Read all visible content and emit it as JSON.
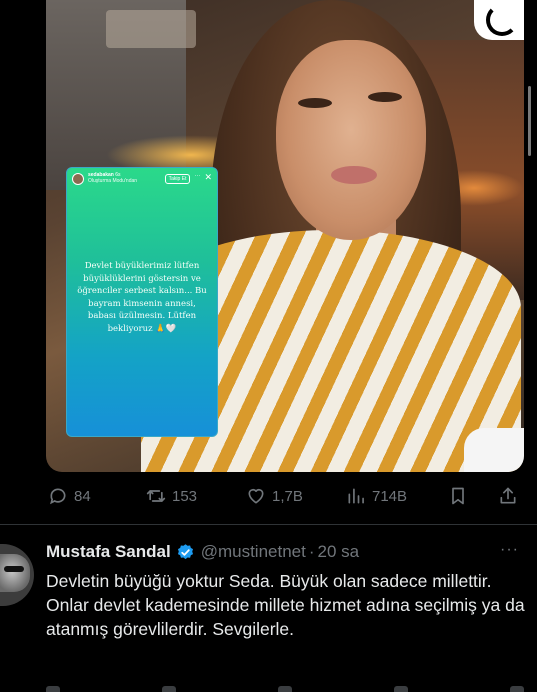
{
  "media": {
    "story": {
      "username": "sedabakan",
      "time": "6s",
      "subtitle": "Oluşturma Modu'ndan",
      "follow_label": "Takip Et",
      "more_glyph": "···",
      "close_glyph": "✕",
      "text": "Devlet büyüklerimiz lütfen büyüklüklerini göstersin ve öğrenciler serbest kalsın... Bu bayram kimsenin annesi, babası üzülmesin. Lütfen bekliyoruz 🙏🤍"
    },
    "icons": [
      "corner-logo-icon"
    ]
  },
  "actions": {
    "reply_count": "84",
    "repost_count": "153",
    "like_count": "1,7B",
    "views_count": "714B",
    "icons": [
      "reply-icon",
      "repost-icon",
      "like-icon",
      "views-icon",
      "bookmark-icon",
      "share-icon"
    ]
  },
  "reply": {
    "name": "Mustafa Sandal",
    "handle": "@mustinetnet",
    "separator": "·",
    "time": "20 sa",
    "more_glyph": "···",
    "text": "Devletin büyüğü yoktur Seda. Büyük olan sadece millettir. Onlar devlet kademesinde millete hizmet adına seçilmiş ya da atanmış görevlilerdir. Sevgilerle."
  },
  "colors": {
    "background": "#000000",
    "text_primary": "#e7e9ea",
    "text_secondary": "#71767b",
    "verified": "#1d9bf0",
    "separator": "#2f3336"
  }
}
